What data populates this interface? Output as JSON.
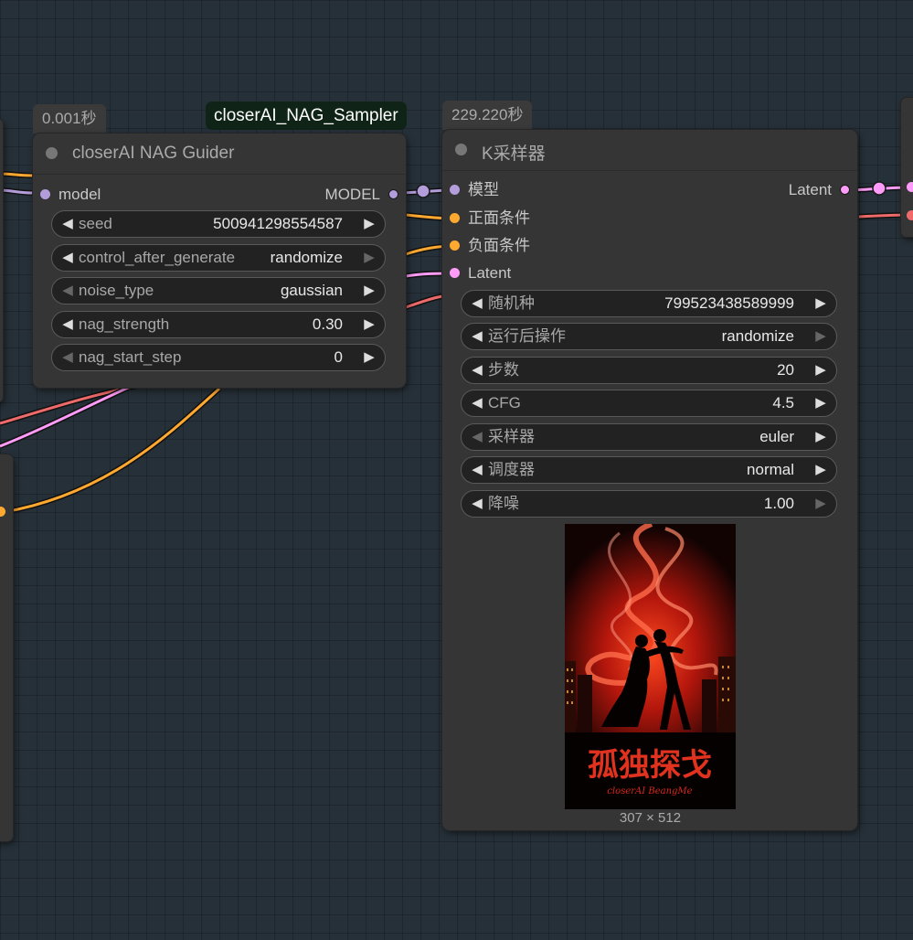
{
  "nodes": {
    "guider": {
      "time": "0.001秒",
      "group_tag": "closerAI_NAG_Sampler",
      "title": "closerAI NAG Guider",
      "input": "model",
      "output": "MODEL",
      "widgets": [
        {
          "label": "seed",
          "value": "500941298554587"
        },
        {
          "label": "control_after_generate",
          "value": "randomize"
        },
        {
          "label": "noise_type",
          "value": "gaussian"
        },
        {
          "label": "nag_strength",
          "value": "0.30"
        },
        {
          "label": "nag_start_step",
          "value": "0"
        }
      ]
    },
    "ksampler": {
      "time": "229.220秒",
      "title": "K采样器",
      "inputs": [
        "模型",
        "正面条件",
        "负面条件",
        "Latent"
      ],
      "output": "Latent",
      "widgets": [
        {
          "label": "随机种",
          "value": "799523438589999"
        },
        {
          "label": "运行后操作",
          "value": "randomize"
        },
        {
          "label": "步数",
          "value": "20"
        },
        {
          "label": "CFG",
          "value": "4.5"
        },
        {
          "label": "采样器",
          "value": "euler"
        },
        {
          "label": "调度器",
          "value": "normal"
        },
        {
          "label": "降噪",
          "value": "1.00"
        }
      ],
      "preview": {
        "title_cn": "孤独探戈",
        "title_en": "closerAI BeangMe",
        "size": "307 × 512"
      }
    }
  },
  "colors": {
    "model": "#b39ddb",
    "conditioning": "#ffa931",
    "latent": "#ff9cf9",
    "negative": "#ef6a6a"
  },
  "icons": {
    "left_arrow": "◀",
    "right_arrow": "▶"
  }
}
